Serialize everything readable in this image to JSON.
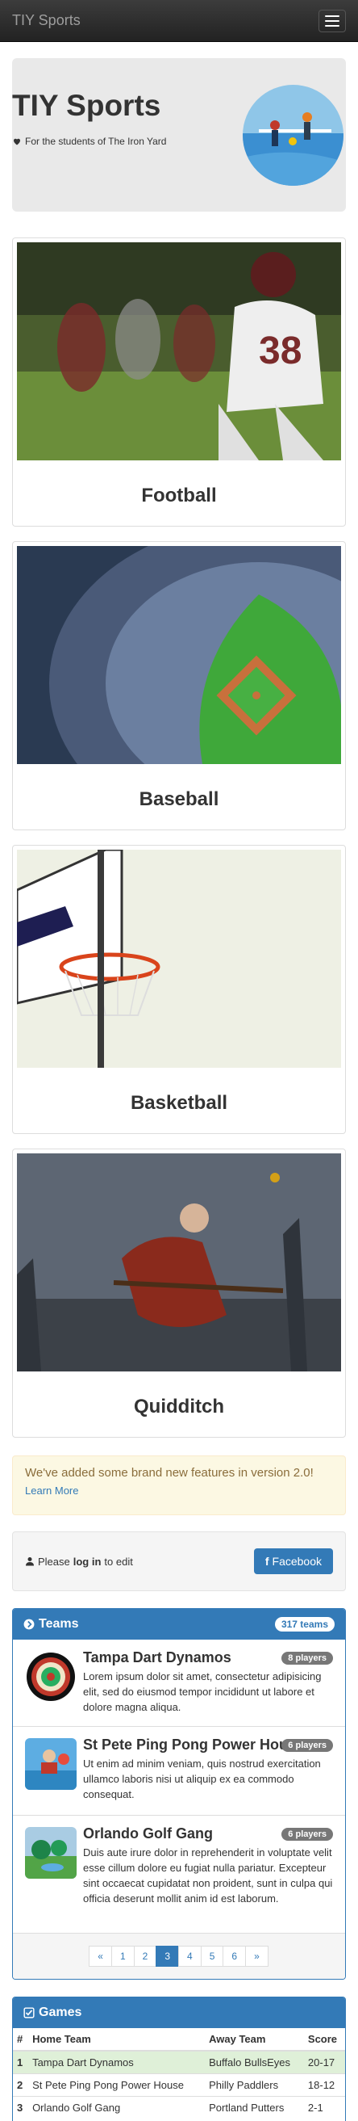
{
  "nav": {
    "brand": "TIY Sports"
  },
  "jumbotron": {
    "title": "TIY Sports",
    "subtitle": "For the students of The Iron Yard"
  },
  "sports": [
    {
      "name": "Football"
    },
    {
      "name": "Baseball"
    },
    {
      "name": "Basketball"
    },
    {
      "name": "Quidditch"
    }
  ],
  "alert": {
    "message": "We've added some brand new features in version 2.0!",
    "link": "Learn More"
  },
  "login": {
    "prefix": "Please",
    "link": "log in",
    "suffix": "to edit",
    "facebook": "Facebook"
  },
  "teams_panel": {
    "title": "Teams",
    "count": "317 teams",
    "teams": [
      {
        "name": "Tampa Dart Dynamos",
        "players": "8 players",
        "desc": "Lorem ipsum dolor sit amet, consectetur adipisicing elit, sed do eiusmod tempor incididunt ut labore et dolore magna aliqua."
      },
      {
        "name": "St Pete Ping Pong Power House",
        "players": "6 players",
        "desc": "Ut enim ad minim veniam, quis nostrud exercitation ullamco laboris nisi ut aliquip ex ea commodo consequat."
      },
      {
        "name": "Orlando Golf Gang",
        "players": "6 players",
        "desc": "Duis aute irure dolor in reprehenderit in voluptate velit esse cillum dolore eu fugiat nulla pariatur. Excepteur sint occaecat cupidatat non proident, sunt in culpa qui officia deserunt mollit anim id est laborum."
      }
    ],
    "pagination": [
      "«",
      "1",
      "2",
      "3",
      "4",
      "5",
      "6",
      "»"
    ],
    "active_page": "3"
  },
  "games_panel": {
    "title": "Games",
    "headers": [
      "#",
      "Home Team",
      "Away Team",
      "Score"
    ],
    "rows": [
      [
        "1",
        "Tampa Dart Dynamos",
        "Buffalo BullsEyes",
        "20-17"
      ],
      [
        "2",
        "St Pete Ping Pong Power House",
        "Philly Paddlers",
        "18-12"
      ],
      [
        "3",
        "Orlando Golf Gang",
        "Portland Putters",
        "2-1"
      ]
    ]
  },
  "colors": {
    "primary": "#337ab7",
    "navbar": "#222222",
    "jumbotron": "#e9e9e9",
    "alert_bg": "#fcf8e3",
    "success_row": "#dff0d8"
  }
}
